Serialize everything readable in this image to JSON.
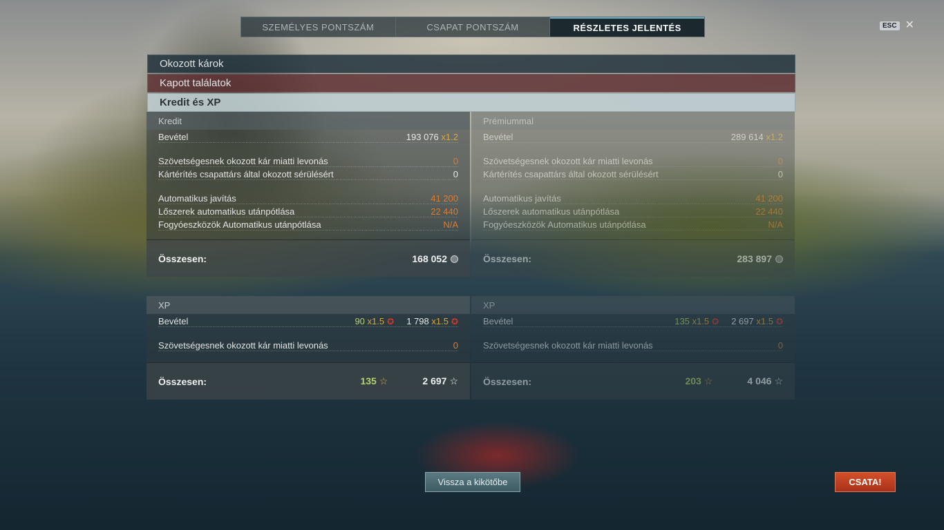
{
  "tabs": [
    {
      "label": "SZEMÉLYES PONTSZÁM"
    },
    {
      "label": "CSAPAT PONTSZÁM"
    },
    {
      "label": "RÉSZLETES JELENTÉS"
    }
  ],
  "esc": {
    "key": "ESC"
  },
  "sections": {
    "damage": "Okozott károk",
    "hits": "Kapott találatok",
    "credit_xp": "Kredit és XP"
  },
  "credit": {
    "title": "Kredit",
    "income_label": "Bevétel",
    "income_value": "193 076",
    "income_mult": "x1.2",
    "ally_damage_label": "Szövetségesnek okozott kár miatti levonás",
    "ally_damage_value": "0",
    "compensation_label": "Kártérítés csapattárs által okozott sérülésért",
    "compensation_value": "0",
    "repair_label": "Automatikus javítás",
    "repair_value": "41 200",
    "ammo_label": "Lőszerek automatikus utánpótlása",
    "ammo_value": "22 440",
    "consumables_label": "Fogyóeszközök Automatikus utánpótlása",
    "consumables_value": "N/A",
    "total_label": "Összesen:",
    "total_value": "168 052"
  },
  "premium_credit": {
    "title": "Prémiummal",
    "income_label": "Bevétel",
    "income_value": "289 614",
    "income_mult": "x1.2",
    "ally_damage_label": "Szövetségesnek okozott kár miatti levonás",
    "ally_damage_value": "0",
    "compensation_label": "Kártérítés csapattárs által okozott sérülésért",
    "compensation_value": "0",
    "repair_label": "Automatikus javítás",
    "repair_value": "41 200",
    "ammo_label": "Lőszerek automatikus utánpótlása",
    "ammo_value": "22 440",
    "consumables_label": "Fogyóeszközök Automatikus utánpótlása",
    "consumables_value": "N/A",
    "total_label": "Összesen:",
    "total_value": "283 897"
  },
  "xp": {
    "title": "XP",
    "income_label": "Bevétel",
    "income_xp": "90",
    "income_xp_mult": "x1.5",
    "income_free": "1 798",
    "income_free_mult": "x1.5",
    "ally_damage_label": "Szövetségesnek okozott kár miatti levonás",
    "ally_damage_value": "0",
    "total_label": "Összesen:",
    "total_xp": "135",
    "total_free": "2 697"
  },
  "premium_xp": {
    "title": "XP",
    "income_label": "Bevétel",
    "income_xp": "135",
    "income_xp_mult": "x1.5",
    "income_free": "2 697",
    "income_free_mult": "x1.5",
    "ally_damage_label": "Szövetségesnek okozott kár miatti levonás",
    "ally_damage_value": "0",
    "total_label": "Összesen:",
    "total_xp": "203",
    "total_free": "4 046"
  },
  "buttons": {
    "back": "Vissza a kikötőbe",
    "battle": "CSATA!"
  },
  "icons": {
    "credit": "coin-icon",
    "xp": "star-icon",
    "bonus": "flag-badge-icon"
  }
}
